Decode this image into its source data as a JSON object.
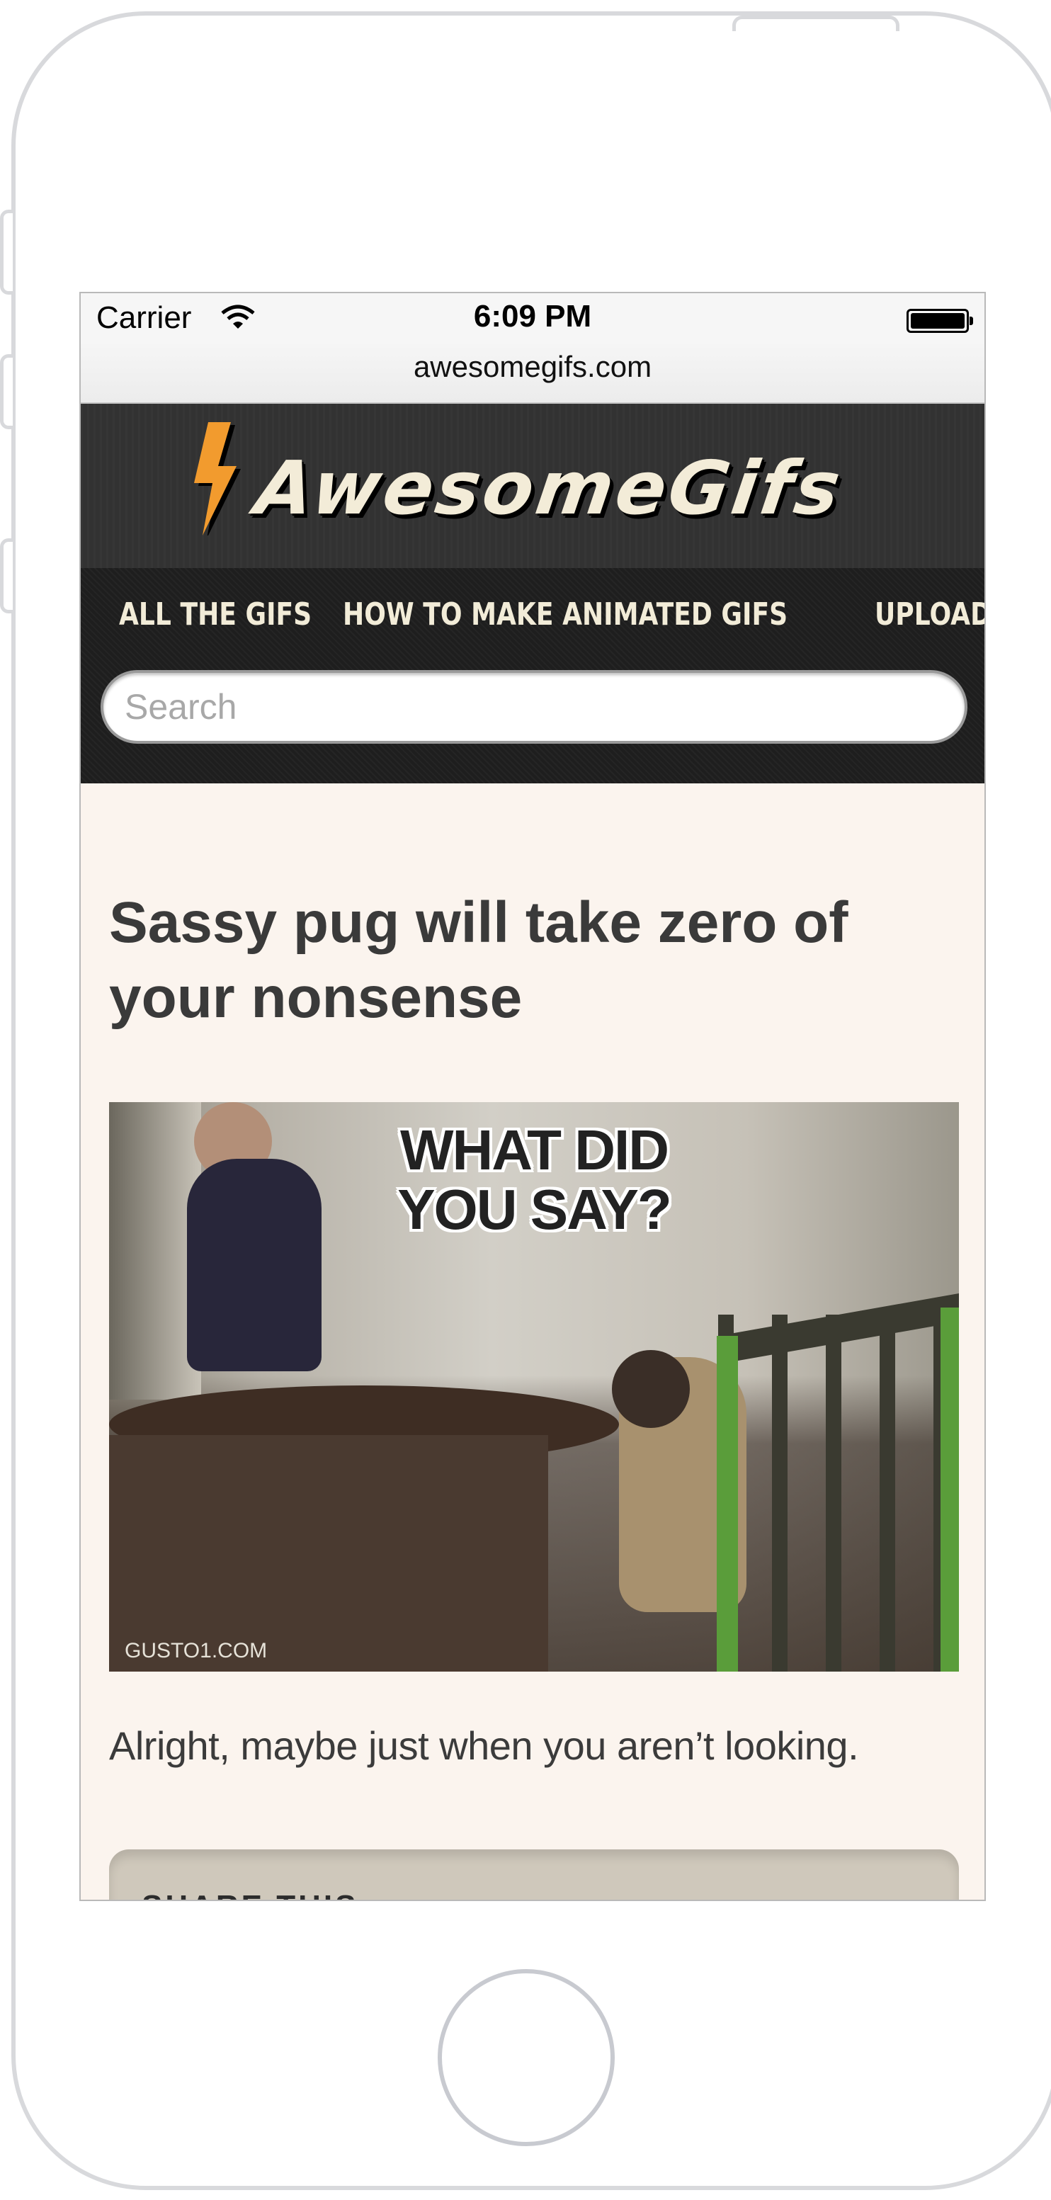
{
  "status_bar": {
    "carrier": "Carrier",
    "time": "6:09 PM"
  },
  "url_bar": {
    "url": "awesomegifs.com"
  },
  "site": {
    "logo_text": "AwesomeGifs"
  },
  "nav": {
    "items": [
      "ALL THE GIFS",
      "HOW TO MAKE ANIMATED GIFS",
      "UPLOAD GIFS"
    ]
  },
  "search": {
    "placeholder": "Search"
  },
  "article": {
    "headline": "Sassy pug will take zero of your nonsense",
    "gif_caption": "WHAT DID YOU SAY?",
    "gif_credit": "GUSTO1.COM",
    "summary": "Alright, maybe just when you aren’t looking."
  },
  "share": {
    "title": "SHARE THIS"
  },
  "colors": {
    "accent": "#f29b2e",
    "header_bg": "#323232",
    "nav_bg": "#1e1e1e",
    "page_bg": "#fbf4ee",
    "nav_text": "#f2ecd8"
  }
}
